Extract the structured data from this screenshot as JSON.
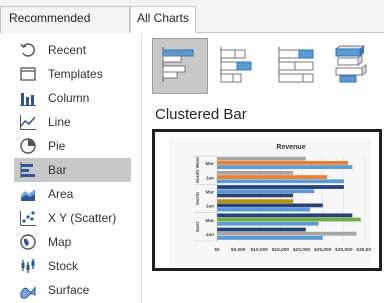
{
  "tabs": [
    {
      "label": "Recommended Charts"
    },
    {
      "label": "All Charts"
    }
  ],
  "sidebar": {
    "items": [
      {
        "label": "Recent",
        "icon": "recent-icon"
      },
      {
        "label": "Templates",
        "icon": "templates-icon"
      },
      {
        "label": "Column",
        "icon": "column-chart-icon"
      },
      {
        "label": "Line",
        "icon": "line-chart-icon"
      },
      {
        "label": "Pie",
        "icon": "pie-chart-icon"
      },
      {
        "label": "Bar",
        "icon": "bar-chart-icon",
        "selected": true
      },
      {
        "label": "Area",
        "icon": "area-chart-icon"
      },
      {
        "label": "X Y (Scatter)",
        "icon": "scatter-chart-icon"
      },
      {
        "label": "Map",
        "icon": "map-chart-icon"
      },
      {
        "label": "Stock",
        "icon": "stock-chart-icon"
      },
      {
        "label": "Surface",
        "icon": "surface-chart-icon"
      }
    ]
  },
  "subtypes": [
    {
      "icon": "clustered-bar-icon",
      "selected": true
    },
    {
      "icon": "stacked-bar-icon",
      "selected": false
    },
    {
      "icon": "100-percent-stacked-bar-icon",
      "selected": false
    },
    {
      "icon": "3d-clustered-bar-icon",
      "selected": false
    }
  ],
  "heading": "Clustered Bar",
  "colors": {
    "accent_blue": "#5b9bd5",
    "accent_orange": "#ed7d31",
    "accent_gray": "#a5a5a5",
    "accent_gold": "#bf9000",
    "accent_navy": "#264478",
    "accent_green": "#70ad47",
    "accent_dark_blue": "#255e91"
  },
  "chart_data": {
    "type": "bar",
    "orientation": "horizontal",
    "title": "Revenue",
    "groups": [
      {
        "name": "South West",
        "categories": [
          "Mar",
          "Jan"
        ]
      },
      {
        "name": "North",
        "categories": [
          "Mar",
          "Jan"
        ]
      },
      {
        "name": "East",
        "categories": [
          "Mar",
          "Jan"
        ]
      }
    ],
    "xlim": [
      0,
      35000
    ],
    "xticks": [
      "$0",
      "$5,000",
      "$10,000",
      "$15,000",
      "$20,000",
      "$25,000",
      "$30,000",
      "$35,000"
    ],
    "grid": true,
    "rows": [
      {
        "group": "South West",
        "category": "Mar",
        "bars": [
          {
            "value": 21000,
            "color": "#a5a5a5"
          },
          {
            "value": 31000,
            "color": "#ed7d31"
          },
          {
            "value": 32000,
            "color": "#5b9bd5"
          }
        ]
      },
      {
        "group": "South West",
        "category": "Jan",
        "bars": [
          {
            "value": 18000,
            "color": "#a5a5a5"
          },
          {
            "value": 26000,
            "color": "#ed7d31"
          },
          {
            "value": 30000,
            "color": "#5b9bd5"
          }
        ]
      },
      {
        "group": "North",
        "category": "Mar",
        "bars": [
          {
            "value": 30000,
            "color": "#264478"
          },
          {
            "value": 23000,
            "color": "#5b9bd5"
          },
          {
            "value": 18000,
            "color": "#264478"
          }
        ]
      },
      {
        "group": "North",
        "category": "Jan",
        "bars": [
          {
            "value": 18000,
            "color": "#bf9000"
          },
          {
            "value": 25000,
            "color": "#264478"
          },
          {
            "value": 22000,
            "color": "#5b9bd5"
          }
        ]
      },
      {
        "group": "East",
        "category": "Mar",
        "bars": [
          {
            "value": 32000,
            "color": "#264478"
          },
          {
            "value": 34000,
            "color": "#70ad47"
          },
          {
            "value": 24000,
            "color": "#5b9bd5"
          }
        ]
      },
      {
        "group": "East",
        "category": "Jan",
        "bars": [
          {
            "value": 21000,
            "color": "#264478"
          },
          {
            "value": 33000,
            "color": "#a5a5a5"
          },
          {
            "value": 25000,
            "color": "#5b9bd5"
          }
        ]
      }
    ]
  }
}
